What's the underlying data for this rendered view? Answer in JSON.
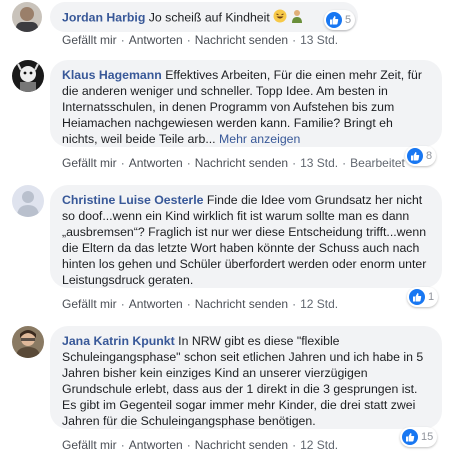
{
  "comments": [
    {
      "author": "Jordan Harbig",
      "text": "Jo scheiß auf Kindheit",
      "more": "",
      "actions": {
        "like": "Gefällt mir",
        "reply": "Antworten",
        "message": "Nachricht senden",
        "time": "13 Std.",
        "edited": ""
      },
      "reactions": "5"
    },
    {
      "author": "Klaus Hagemann",
      "text": "Effektives Arbeiten, Für die einen mehr Zeit, für die anderen weniger und schneller. Topp Idee. Am besten in Internatsschulen, in denen Programm von Aufstehen bis zum Heiamachen nachgewiesen werden kann. Familie? Bringt eh nichts, weil beide Teile arb...",
      "more": "Mehr anzeigen",
      "actions": {
        "like": "Gefällt mir",
        "reply": "Antworten",
        "message": "Nachricht senden",
        "time": "13 Std.",
        "edited": "Bearbeitet"
      },
      "reactions": "8"
    },
    {
      "author": "Christine Luise Oesterle",
      "text": "Finde die Idee vom Grundsatz her nicht so doof...wenn ein Kind wirklich fit ist warum sollte man es dann „ausbremsen“? Fraglich ist nur wer diese Entscheidung trifft...wenn die Eltern da das letzte Wort haben könnte der Schuss auch nach hinten los gehen und Schüler überfordert werden oder enorm unter Leistungsdruck geraten.",
      "more": "",
      "actions": {
        "like": "Gefällt mir",
        "reply": "Antworten",
        "message": "Nachricht senden",
        "time": "12 Std.",
        "edited": ""
      },
      "reactions": "1"
    },
    {
      "author": "Jana Katrin Kpunkt",
      "text": "In NRW gibt es diese \"flexible Schuleingangsphase\" schon seit etlichen Jahren und ich habe in 5 Jahren bisher kein einziges Kind an unserer vierzügigen Grundschule erlebt, dass aus der 1 direkt in die 3 gesprungen ist. Es gibt im Gegenteil sogar immer mehr Kinder, die drei statt zwei Jahren für die Schuleingangsphase benötigen.",
      "more": "",
      "actions": {
        "like": "Gefällt mir",
        "reply": "Antworten",
        "message": "Nachricht senden",
        "time": "12 Std.",
        "edited": ""
      },
      "reactions": "15"
    }
  ],
  "icons": {
    "like": "thumbs-up-icon",
    "emoji1": "laughing-emoji-icon",
    "emoji2": "person-emoji-icon"
  },
  "colors": {
    "link": "#385898",
    "bubble": "#f2f3f5",
    "like": "#1877f2"
  }
}
